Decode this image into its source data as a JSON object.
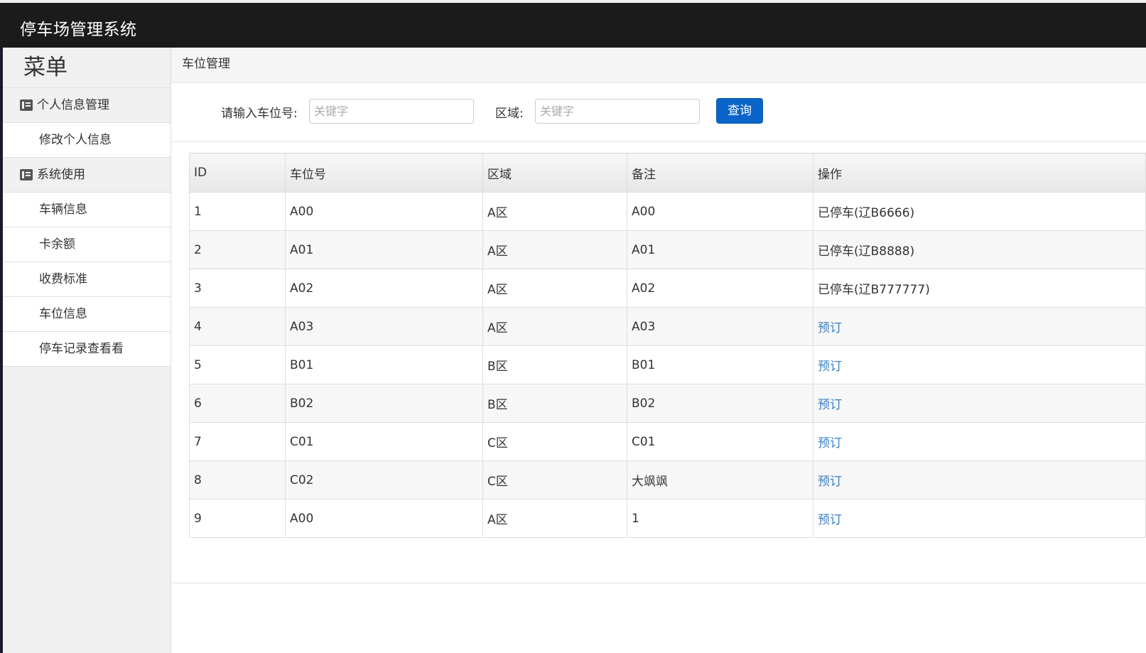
{
  "app": {
    "title": "停车场管理系统"
  },
  "sidebar": {
    "menu_title": "菜单",
    "groups": [
      {
        "label": "个人信息管理",
        "icon": "list-icon",
        "items": [
          {
            "label": "修改个人信息"
          }
        ]
      },
      {
        "label": "系统使用",
        "icon": "list-icon",
        "items": [
          {
            "label": "车辆信息"
          },
          {
            "label": "卡余额"
          },
          {
            "label": "收费标准"
          },
          {
            "label": "车位信息"
          },
          {
            "label": "停车记录查看看"
          }
        ]
      }
    ]
  },
  "breadcrumb": "车位管理",
  "search": {
    "space_label": "请输入车位号:",
    "space_placeholder": "关键字",
    "space_value": "",
    "area_label": "区域:",
    "area_placeholder": "关键字",
    "area_value": "",
    "button": "查询"
  },
  "table": {
    "columns": [
      "ID",
      "车位号",
      "区域",
      "备注",
      "操作"
    ],
    "rows": [
      {
        "id": "1",
        "space": "A00",
        "area": "A区",
        "note": "A00",
        "action": "已停车(辽B6666)",
        "action_link": false
      },
      {
        "id": "2",
        "space": "A01",
        "area": "A区",
        "note": "A01",
        "action": "已停车(辽B8888)",
        "action_link": false
      },
      {
        "id": "3",
        "space": "A02",
        "area": "A区",
        "note": "A02",
        "action": "已停车(辽B777777)",
        "action_link": false
      },
      {
        "id": "4",
        "space": "A03",
        "area": "A区",
        "note": "A03",
        "action": "预订",
        "action_link": true
      },
      {
        "id": "5",
        "space": "B01",
        "area": "B区",
        "note": "B01",
        "action": "预订",
        "action_link": true
      },
      {
        "id": "6",
        "space": "B02",
        "area": "B区",
        "note": "B02",
        "action": "预订",
        "action_link": true
      },
      {
        "id": "7",
        "space": "C01",
        "area": "C区",
        "note": "C01",
        "action": "预订",
        "action_link": true
      },
      {
        "id": "8",
        "space": "C02",
        "area": "C区",
        "note": "大飒飒",
        "action": "预订",
        "action_link": true
      },
      {
        "id": "9",
        "space": "A00",
        "area": "A区",
        "note": "1",
        "action": "预订",
        "action_link": true
      }
    ]
  },
  "colors": {
    "topbar": "#1b1b1b",
    "primary_button": "#0b64c8",
    "link": "#3a7fc1",
    "sidebar_bg": "#f0f0f0"
  }
}
